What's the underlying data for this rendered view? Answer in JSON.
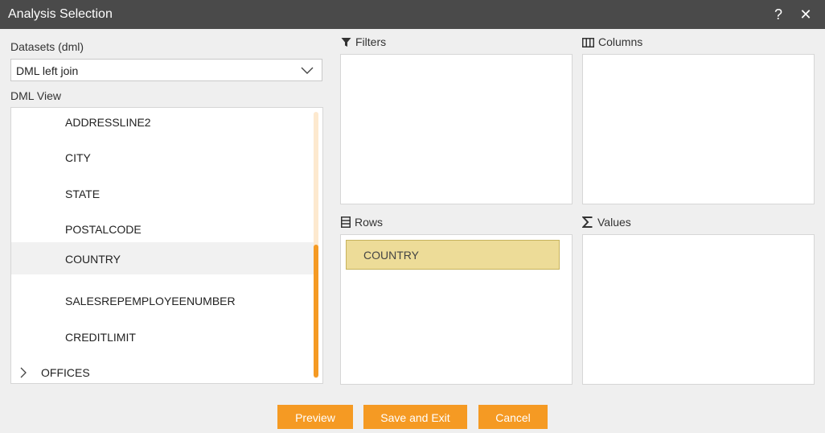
{
  "window": {
    "title": "Analysis Selection",
    "help_label": "?",
    "close_label": "✕"
  },
  "datasets": {
    "label": "Datasets (dml)",
    "selected": "DML left join"
  },
  "tree": {
    "label": "DML View",
    "items": [
      {
        "label": "ADDRESSLINE2"
      },
      {
        "label": "CITY"
      },
      {
        "label": "STATE"
      },
      {
        "label": "POSTALCODE"
      },
      {
        "label": "COUNTRY",
        "selected": true
      },
      {
        "label": "SALESREPEMPLOYEENUMBER"
      },
      {
        "label": "CREDITLIMIT"
      },
      {
        "label": "OFFICES",
        "expandable": true
      }
    ]
  },
  "panels": {
    "filters": {
      "label": "Filters",
      "icon": "filter-icon"
    },
    "columns": {
      "label": "Columns",
      "icon": "columns-icon"
    },
    "rows": {
      "label": "Rows",
      "icon": "rows-icon",
      "items": [
        "COUNTRY"
      ]
    },
    "values": {
      "label": "Values",
      "icon": "sigma-icon"
    }
  },
  "buttons": {
    "preview": "Preview",
    "save_exit": "Save and Exit",
    "cancel": "Cancel"
  },
  "colors": {
    "accent": "#f59a23",
    "titlebar": "#4a4a4a",
    "chip": "#eddc98"
  }
}
